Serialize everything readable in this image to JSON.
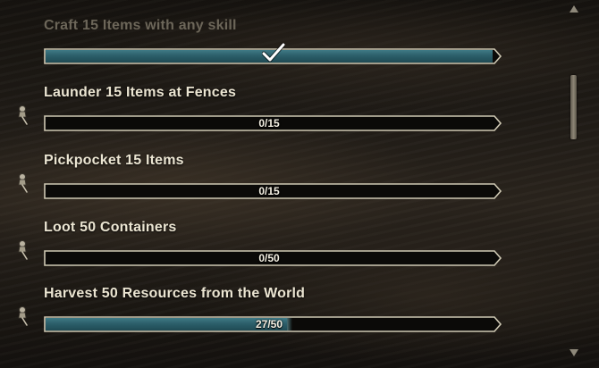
{
  "colors": {
    "bar_fill": "#2c5f6a",
    "bar_border": "#cfc9b4",
    "title_active": "#ebe5d2",
    "title_done": "#6c6659"
  },
  "icons": {
    "pin": "pushpin-icon",
    "check": "checkmark-icon",
    "scroll_up": "scroll-up-arrow-icon",
    "scroll_down": "scroll-down-arrow-icon"
  },
  "entries": [
    {
      "title": "Craft 15 Items with any skill",
      "progress": 1.0,
      "progress_text": "",
      "completed": true,
      "pinned": false
    },
    {
      "title": "Launder 15 Items at Fences",
      "progress": 0.0,
      "progress_text": "0/15",
      "completed": false,
      "pinned": true
    },
    {
      "title": "Pickpocket 15 Items",
      "progress": 0.0,
      "progress_text": "0/15",
      "completed": false,
      "pinned": true
    },
    {
      "title": "Loot 50 Containers",
      "progress": 0.0,
      "progress_text": "0/50",
      "completed": false,
      "pinned": true
    },
    {
      "title": "Harvest 50 Resources from the World",
      "progress": 0.54,
      "progress_text": "27/50",
      "completed": false,
      "pinned": true
    }
  ]
}
